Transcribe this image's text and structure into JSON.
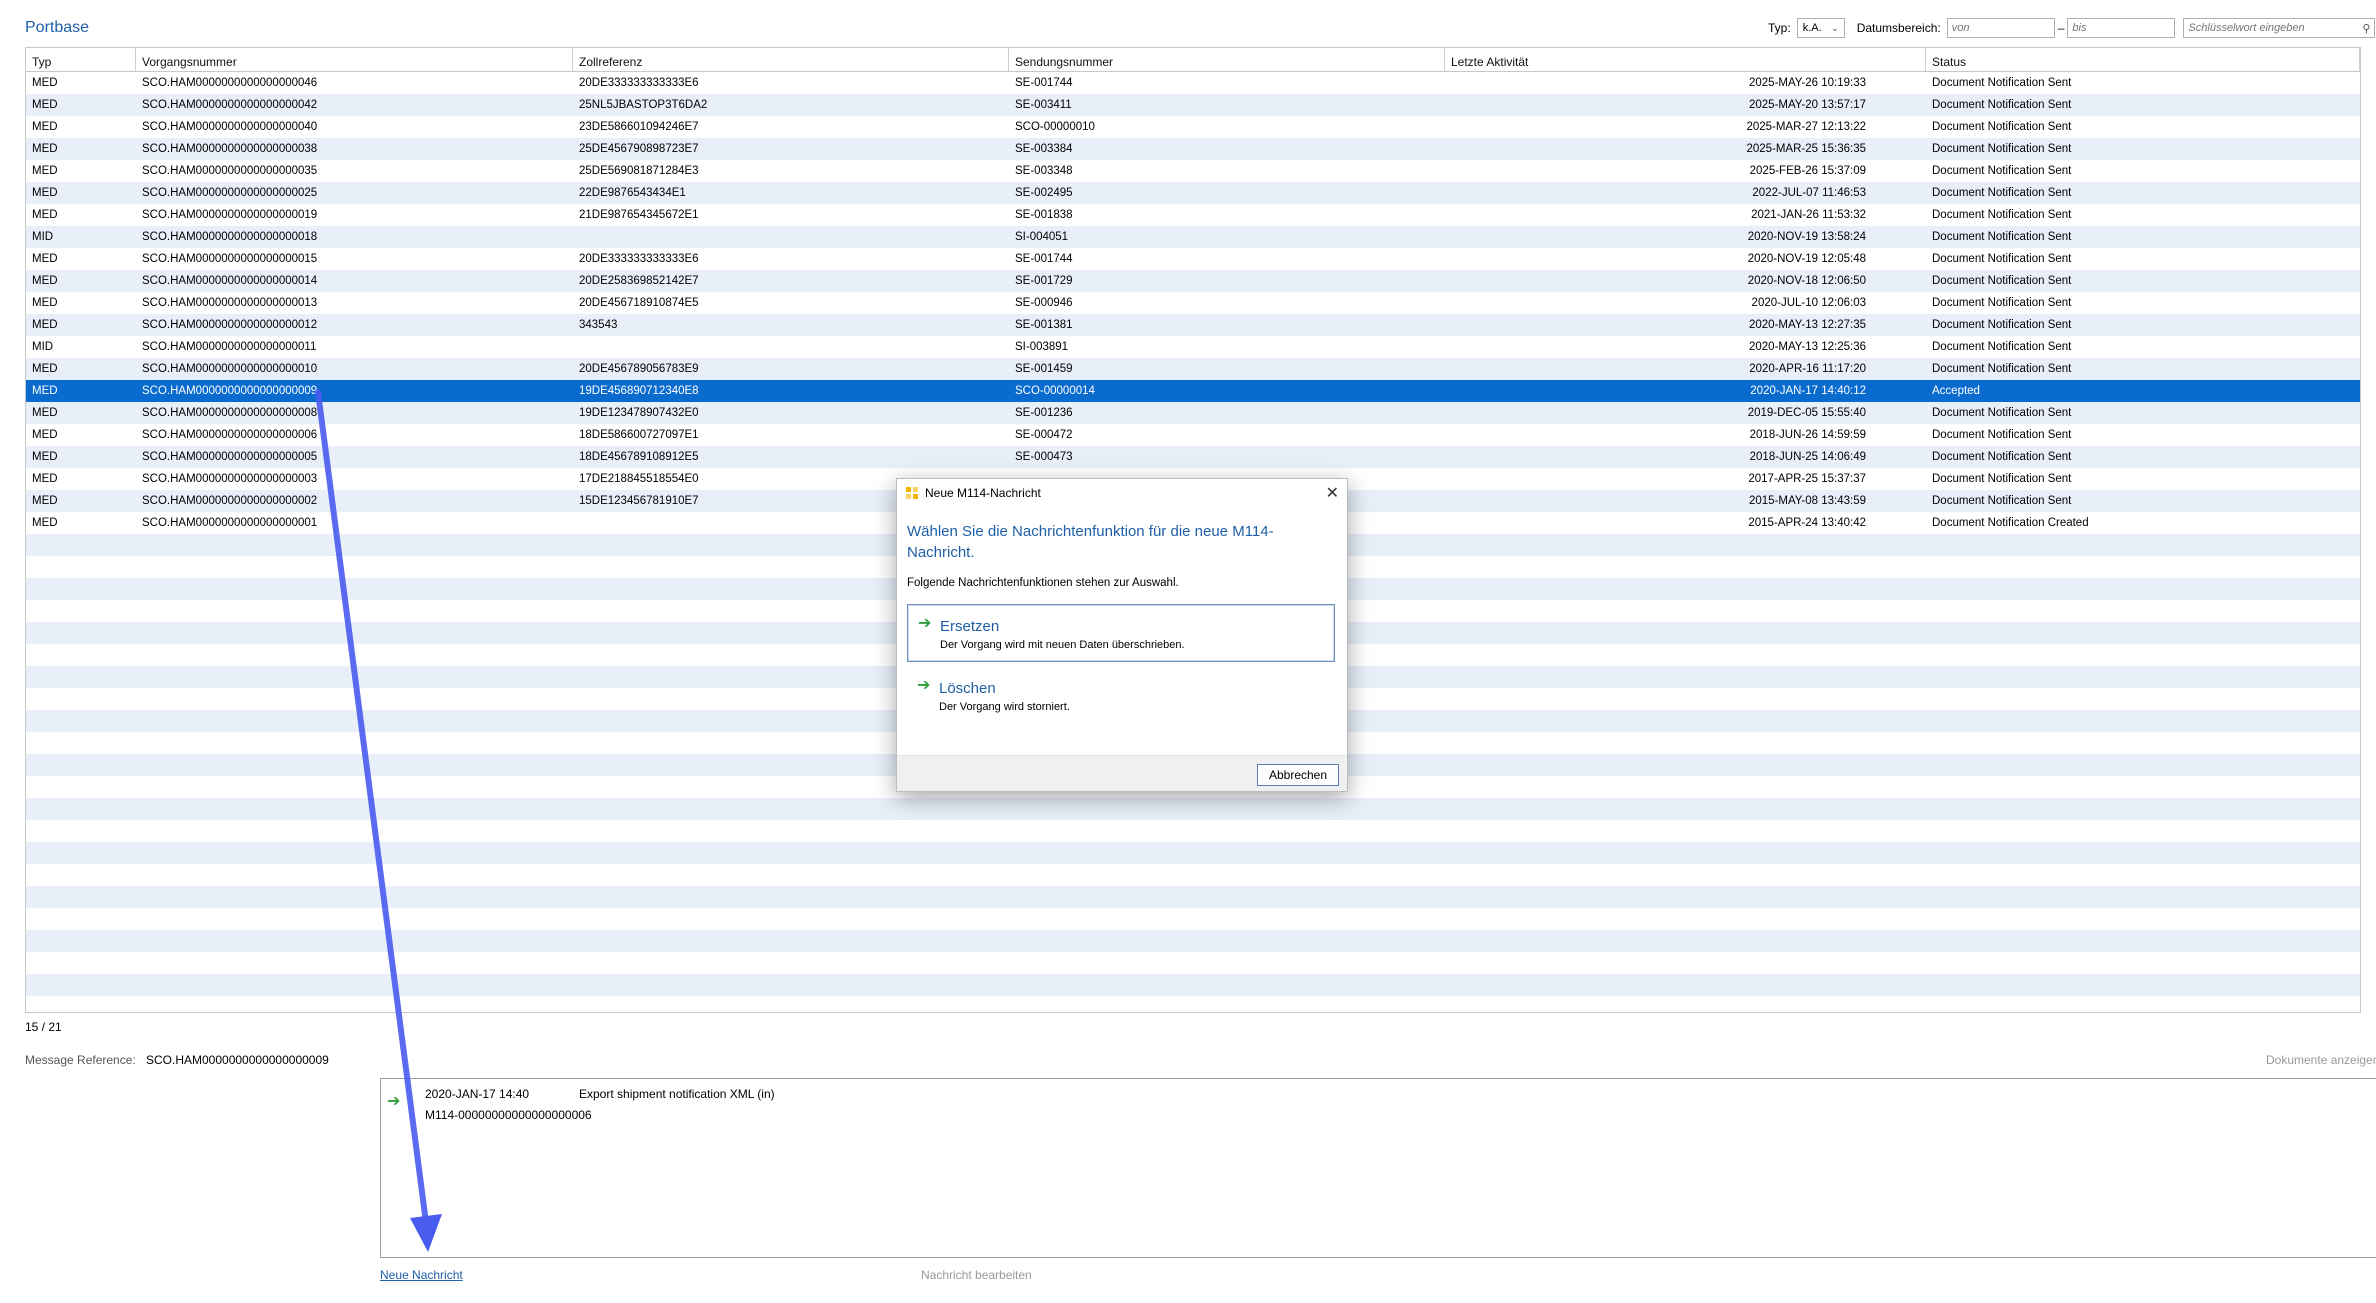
{
  "app": {
    "title": "Portbase"
  },
  "filters": {
    "typ_label": "Typ:",
    "typ_value": "k.A.",
    "date_label": "Datumsbereich:",
    "date_from_placeholder": "von",
    "date_sep": "–",
    "date_to_placeholder": "bis",
    "search_placeholder": "Schlüsselwort eingeben"
  },
  "grid": {
    "headers": [
      "Typ",
      "Vorgangsnummer",
      "Zollreferenz",
      "Sendungsnummer",
      "Letzte Aktivität",
      "Status"
    ],
    "rows": [
      [
        "MED",
        "SCO.HAM0000000000000000046",
        "20DE333333333333E6",
        "SE-001744",
        "2025-MAY-26 10:19:33",
        "Document Notification Sent"
      ],
      [
        "MED",
        "SCO.HAM0000000000000000042",
        "25NL5JBASTOP3T6DA2",
        "SE-003411",
        "2025-MAY-20 13:57:17",
        "Document Notification Sent"
      ],
      [
        "MED",
        "SCO.HAM0000000000000000040",
        "23DE586601094246E7",
        "SCO-00000010",
        "2025-MAR-27 12:13:22",
        "Document Notification Sent"
      ],
      [
        "MED",
        "SCO.HAM0000000000000000038",
        "25DE456790898723E7",
        "SE-003384",
        "2025-MAR-25 15:36:35",
        "Document Notification Sent"
      ],
      [
        "MED",
        "SCO.HAM0000000000000000035",
        "25DE569081871284E3",
        "SE-003348",
        "2025-FEB-26 15:37:09",
        "Document Notification Sent"
      ],
      [
        "MED",
        "SCO.HAM0000000000000000025",
        "22DE9876543434E1",
        "SE-002495",
        "2022-JUL-07 11:46:53",
        "Document Notification Sent"
      ],
      [
        "MED",
        "SCO.HAM0000000000000000019",
        "21DE987654345672E1",
        "SE-001838",
        "2021-JAN-26 11:53:32",
        "Document Notification Sent"
      ],
      [
        "MID",
        "SCO.HAM0000000000000000018",
        "",
        "SI-004051",
        "2020-NOV-19 13:58:24",
        "Document Notification Sent"
      ],
      [
        "MED",
        "SCO.HAM0000000000000000015",
        "20DE333333333333E6",
        "SE-001744",
        "2020-NOV-19 12:05:48",
        "Document Notification Sent"
      ],
      [
        "MED",
        "SCO.HAM0000000000000000014",
        "20DE258369852142E7",
        "SE-001729",
        "2020-NOV-18 12:06:50",
        "Document Notification Sent"
      ],
      [
        "MED",
        "SCO.HAM0000000000000000013",
        "20DE456718910874E5",
        "SE-000946",
        "2020-JUL-10 12:06:03",
        "Document Notification Sent"
      ],
      [
        "MED",
        "SCO.HAM0000000000000000012",
        "343543",
        "SE-001381",
        "2020-MAY-13 12:27:35",
        "Document Notification Sent"
      ],
      [
        "MID",
        "SCO.HAM0000000000000000011",
        "",
        "SI-003891",
        "2020-MAY-13 12:25:36",
        "Document Notification Sent"
      ],
      [
        "MED",
        "SCO.HAM0000000000000000010",
        "20DE456789056783E9",
        "SE-001459",
        "2020-APR-16 11:17:20",
        "Document Notification Sent"
      ],
      [
        "MED",
        "SCO.HAM0000000000000000009",
        "19DE456890712340E8",
        "SCO-00000014",
        "2020-JAN-17 14:40:12",
        "Accepted"
      ],
      [
        "MED",
        "SCO.HAM0000000000000000008",
        "19DE123478907432E0",
        "SE-001236",
        "2019-DEC-05 15:55:40",
        "Document Notification Sent"
      ],
      [
        "MED",
        "SCO.HAM0000000000000000006",
        "18DE586600727097E1",
        "SE-000472",
        "2018-JUN-26 14:59:59",
        "Document Notification Sent"
      ],
      [
        "MED",
        "SCO.HAM0000000000000000005",
        "18DE456789108912E5",
        "SE-000473",
        "2018-JUN-25 14:06:49",
        "Document Notification Sent"
      ],
      [
        "MED",
        "SCO.HAM0000000000000000003",
        "17DE218845518554E0",
        "",
        "2017-APR-25 15:37:37",
        "Document Notification Sent"
      ],
      [
        "MED",
        "SCO.HAM0000000000000000002",
        "15DE123456781910E7",
        "",
        "2015-MAY-08 13:43:59",
        "Document Notification Sent"
      ],
      [
        "MED",
        "SCO.HAM0000000000000000001",
        "",
        "",
        "2015-APR-24 13:40:42",
        "Document Notification Created"
      ]
    ],
    "selected_index": 14
  },
  "page_count": "15 / 21",
  "message_reference": {
    "label": "Message Reference:",
    "value": "SCO.HAM0000000000000000009"
  },
  "docs_link": "Dokumente anzeigen",
  "history": {
    "date": "2020-JAN-17 14:40",
    "description": "Export shipment notification XML (in)",
    "id": "M114-00000000000000000006"
  },
  "actions": {
    "new_message": "Neue Nachricht",
    "edit_message": "Nachricht bearbeiten"
  },
  "dialog": {
    "title": "Neue M114-Nachricht",
    "heading": "Wählen Sie die Nachrichtenfunktion für die neue M114-Nachricht.",
    "subtext": "Folgende Nachrichtenfunktionen stehen zur Auswahl.",
    "options": [
      {
        "title": "Ersetzen",
        "desc": "Der Vorgang wird mit neuen Daten überschrieben."
      },
      {
        "title": "Löschen",
        "desc": "Der Vorgang wird storniert."
      }
    ],
    "cancel": "Abbrechen"
  },
  "colors": {
    "accent": "#1f5fa8",
    "selection": "#0a6bcf",
    "arrow": "#4a5cf0",
    "ok_green": "#2e9e3a"
  }
}
